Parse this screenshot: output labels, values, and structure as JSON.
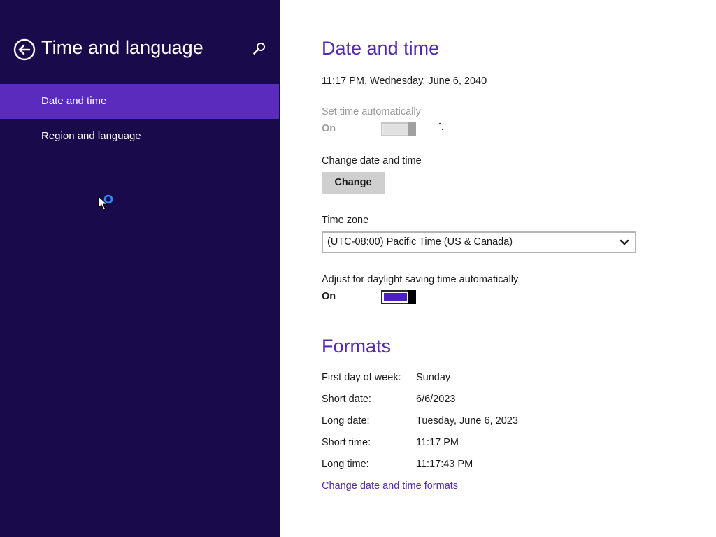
{
  "left_pane": {
    "title": "Time and language",
    "back_icon": "back-arrow-circle-icon",
    "search_icon": "search-magnifier-icon",
    "nav_items": [
      {
        "label": "Date and time",
        "selected": true
      },
      {
        "label": "Region and language",
        "selected": false
      }
    ]
  },
  "date_time": {
    "section_title": "Date and time",
    "current_datetime": "11:17 PM, Wednesday, June 6, 2040",
    "set_time_auto": {
      "label": "Set time automatically",
      "state_label": "On",
      "enabled": false
    },
    "change": {
      "label": "Change date and time",
      "button_label": "Change"
    },
    "time_zone": {
      "label": "Time zone",
      "selected": "(UTC-08:00) Pacific Time (US & Canada)"
    },
    "dst": {
      "label": "Adjust for daylight saving time automatically",
      "state_label": "On",
      "on": true
    }
  },
  "formats": {
    "section_title": "Formats",
    "rows": [
      {
        "label": "First day of week:",
        "value": "Sunday"
      },
      {
        "label": "Short date:",
        "value": "6/6/2023"
      },
      {
        "label": "Long date:",
        "value": "Tuesday, June 6, 2023"
      },
      {
        "label": "Short time:",
        "value": "11:17 PM"
      },
      {
        "label": "Long time:",
        "value": "11:17:43 PM"
      }
    ],
    "change_link": "Change date and time formats"
  },
  "colors": {
    "left_background": "#190a4b",
    "nav_selected": "#5b2bbd",
    "accent": "#5228b4",
    "toggle_on": "#4d1ec2"
  }
}
